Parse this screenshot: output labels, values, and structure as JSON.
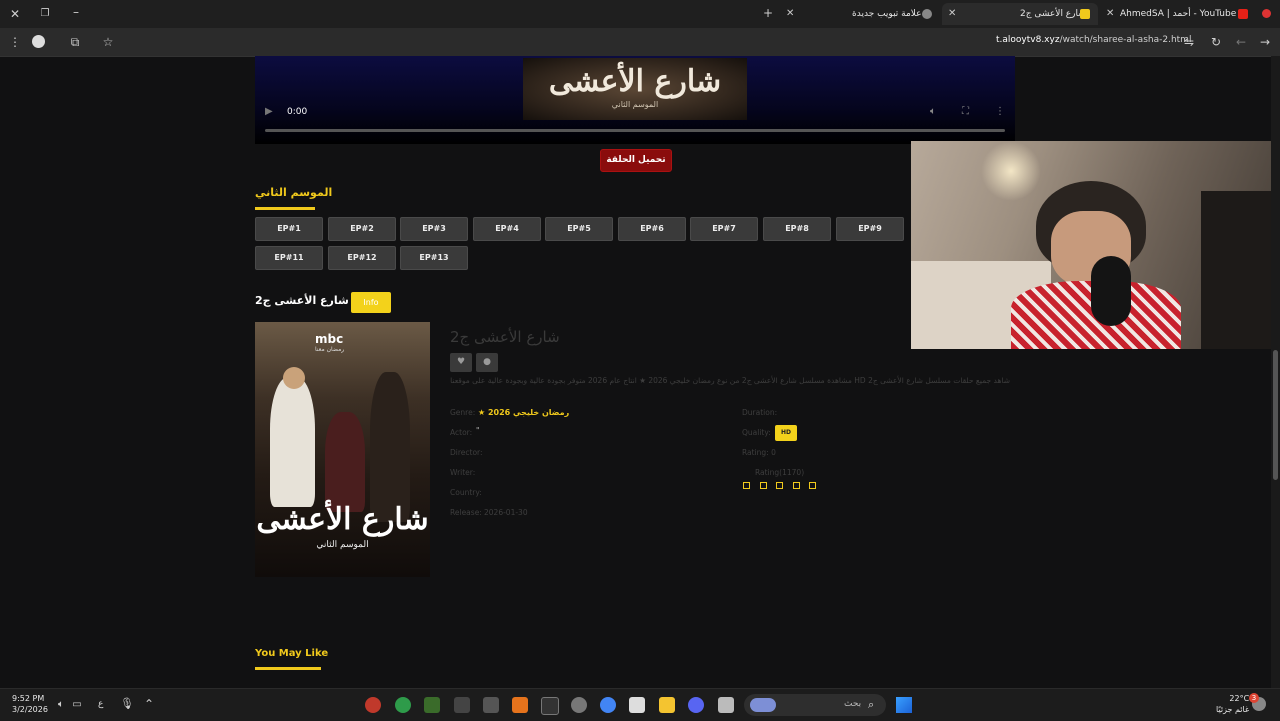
{
  "browser": {
    "tabs": [
      {
        "title": "AhmedSA | أحمد - YouTube",
        "active": false,
        "favicon_color": "#e62117"
      },
      {
        "title": "شارع الأعشى ج2",
        "active": true,
        "favicon_color": "#f0c91c"
      },
      {
        "title": "علامة تبويب جديدة",
        "active": false,
        "favicon_color": "#999999"
      }
    ],
    "url_host": "t.alooytv8.xyz",
    "url_path": "/watch/sharee-al-asha-2.html"
  },
  "video": {
    "time": "0:00",
    "poster_text": "شارع الأعشى",
    "poster_subtext": "الموسم الثاني"
  },
  "download_label": "تحميل الحلقة",
  "season": {
    "title": "الموسم الثاني",
    "episodes": [
      "EP#1",
      "EP#2",
      "EP#3",
      "EP#4",
      "EP#5",
      "EP#6",
      "EP#7",
      "EP#8",
      "EP#9",
      "EP#11",
      "EP#12",
      "EP#13"
    ]
  },
  "series": {
    "title": "شارع الأعشى ج2",
    "info_label": "Info",
    "info_title": "شارع الأعشى ج2",
    "description": "شاهد جميع حلقات مسلسل شارع الأعشى ج2 HD مشاهدة مسلسل شارع الأعشى ج2 من نوع رمضان خليجي 2026 ★ انتاج عام 2026 متوفر بجودة عالية وبجودة عالية على موقعنا",
    "poster_logo": "mbc",
    "poster_sub": "رمضان معنا",
    "poster_title": "شارع الأعشى",
    "poster_season": "الموسم الثاني"
  },
  "meta": {
    "genre_label": "Genre:",
    "genre_value": "★ رمضان خليجي 2026",
    "actor_label": "Actor:",
    "actor_value": "\"",
    "director_label": "Director:",
    "writer_label": "Writer:",
    "country_label": "Country:",
    "release_label": "Release:",
    "release_value": "2026-01-30",
    "duration_label": "Duration:",
    "quality_label": "Quality:",
    "quality_value": "HD",
    "rating_label": "Rating: 0",
    "rating_count": "Rating(1170)"
  },
  "you_may_like": "You May Like",
  "taskbar": {
    "time": "9:52 PM",
    "date": "3/2/2026",
    "lang": "ع",
    "search_placeholder": "بحث",
    "temp": "22°C",
    "weather": "غائم جزئيًا",
    "notification_count": "3"
  }
}
